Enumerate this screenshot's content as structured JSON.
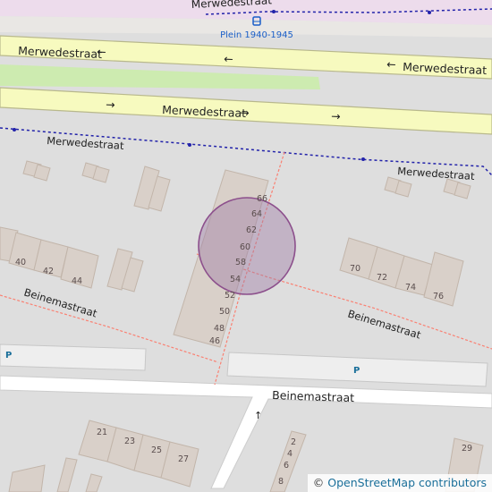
{
  "map": {
    "streets": {
      "merwede_top": "Merwedestraat",
      "merwede_upper_left": "Merwedestraat",
      "merwede_upper_right": "Merwedestraat",
      "merwede_lower": "Merwedestraat",
      "merwede_path_left": "Merwedestraat",
      "merwede_path_right": "Merwedestraat",
      "beinema_left": "Beinemastraat",
      "beinema_right": "Beinemastraat",
      "beinema_main": "Beinemastraat"
    },
    "arrow_left": "←",
    "arrow_right": "→",
    "arrow_up": "↑",
    "bus_stop": "Plein 1940-1945",
    "parking": "P",
    "house_numbers": [
      "66",
      "64",
      "62",
      "60",
      "58",
      "54",
      "52",
      "50",
      "48",
      "46",
      "40",
      "42",
      "44",
      "70",
      "72",
      "74",
      "76",
      "21",
      "23",
      "25",
      "27",
      "2",
      "4",
      "6",
      "8",
      "29"
    ],
    "colors": {
      "background": "#dedede",
      "building": "#d9d0c9",
      "building_stroke": "#c2b5aa",
      "trunk_road": "#f7fabf",
      "trunk_casing": "#b8b88c",
      "pedestrian_area": "#eddcec",
      "footway": "#fa8072",
      "bus_route": "#2222aa",
      "grass": "#cdebb0",
      "marker_fill": "#a07ea6",
      "marker_stroke": "#8c4f8c"
    }
  },
  "attribution": {
    "symbol": "©",
    "link": "OpenStreetMap contributors"
  }
}
